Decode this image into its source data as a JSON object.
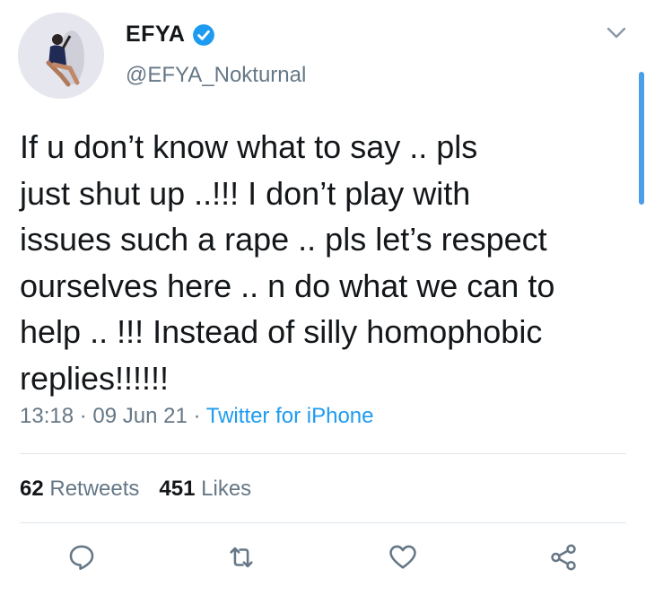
{
  "user": {
    "display_name": "EFYA",
    "handle": "@EFYA_Nokturnal",
    "verified": true
  },
  "tweet": {
    "text": "If u don’t know what to say .. pls\njust shut up ..!!! I don’t play with\nissues such a rape .. pls let’s respect\nourselves here .. n do what we can to\nhelp .. !!! Instead of silly homophobic\nreplies!!!!!!",
    "time": "13:18",
    "date": "09 Jun 21",
    "separator": "·",
    "source": "Twitter for iPhone"
  },
  "stats": {
    "retweets_count": "62",
    "retweets_label": "Retweets",
    "likes_count": "451",
    "likes_label": "Likes"
  },
  "icons": {
    "reply": "reply-icon",
    "retweet": "retweet-icon",
    "like": "heart-icon",
    "share": "share-icon",
    "more": "chevron-down-icon",
    "verified": "verified-badge-icon"
  },
  "colors": {
    "text": "#14171a",
    "secondary": "#657786",
    "link": "#1d9bf0",
    "verified": "#1d9bf0",
    "divider": "#e1e8ed"
  }
}
